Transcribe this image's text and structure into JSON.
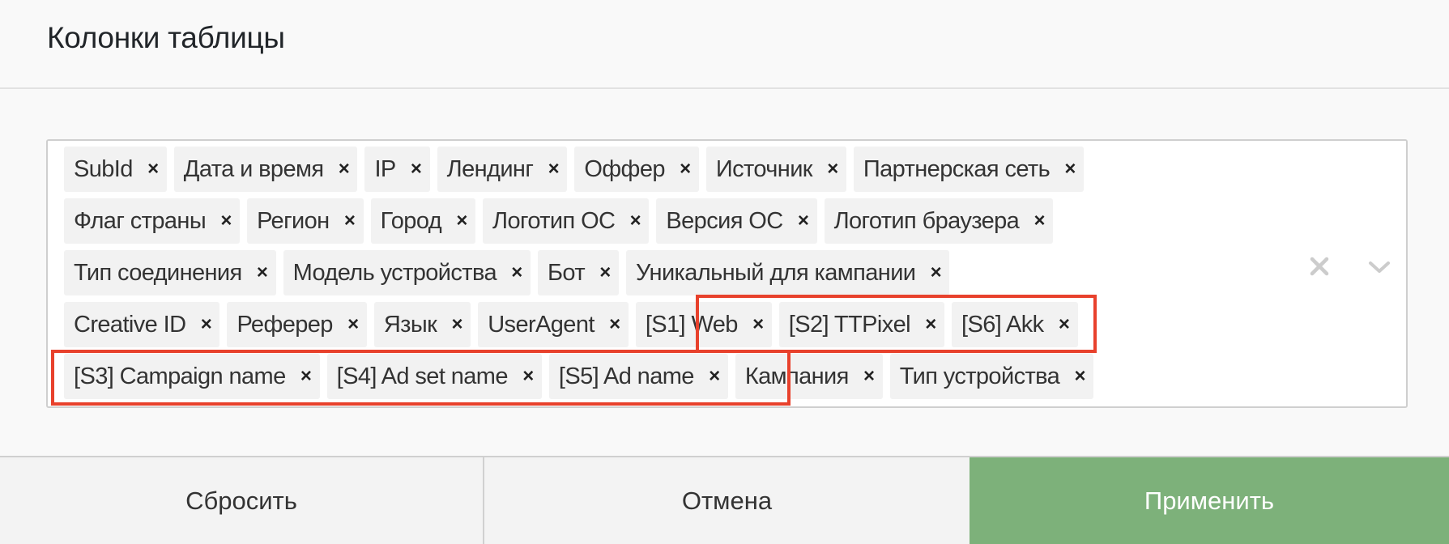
{
  "dialog": {
    "title": "Колонки таблицы"
  },
  "columns_select": {
    "rows": [
      [
        "SubId",
        "Дата и время",
        "IP",
        "Лендинг",
        "Оффер",
        "Источник",
        "Партнерская сеть"
      ],
      [
        "Флаг страны",
        "Регион",
        "Город",
        "Логотип ОС",
        "Версия ОС",
        "Логотип браузера"
      ],
      [
        "Тип соединения",
        "Модель устройства",
        "Бот",
        "Уникальный для кампании"
      ],
      [
        "Creative ID",
        "Реферер",
        "Язык",
        "UserAgent",
        "[S1] Web",
        "[S2] TTPixel",
        "[S6] Akk"
      ],
      [
        "[S3] Campaign name",
        "[S4] Ad set name",
        "[S5] Ad name",
        "Кампания",
        "Тип устройства"
      ]
    ],
    "remove_glyph": "×",
    "highlighted_groups": [
      [
        "[S1] Web",
        "[S2] TTPixel",
        "[S6] Akk"
      ],
      [
        "[S3] Campaign name",
        "[S4] Ad set name",
        "[S5] Ad name"
      ]
    ]
  },
  "footer": {
    "reset_label": "Сбросить",
    "cancel_label": "Отмена",
    "apply_label": "Применить"
  },
  "colors": {
    "apply": "#7db17a",
    "highlight": "#e8412c"
  }
}
